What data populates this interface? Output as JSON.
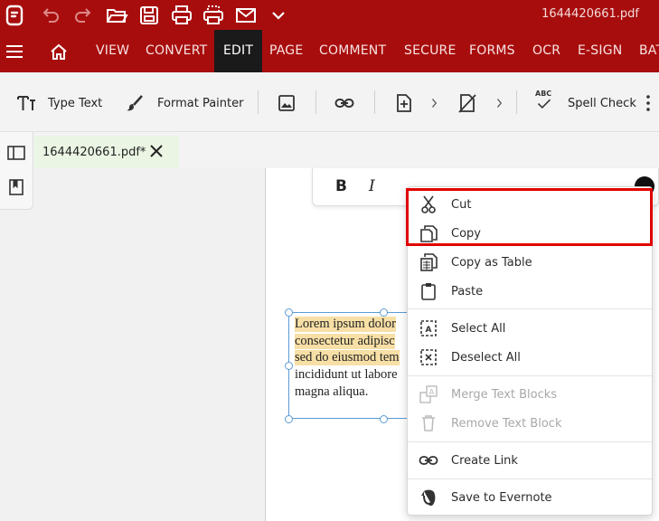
{
  "window": {
    "title": "1644420661.pdf"
  },
  "menubar": {
    "items": [
      {
        "label": "VIEW"
      },
      {
        "label": "CONVERT"
      },
      {
        "label": "EDIT"
      },
      {
        "label": "PAGE"
      },
      {
        "label": "COMMENT"
      },
      {
        "label": "SECURE"
      },
      {
        "label": "FORMS"
      },
      {
        "label": "OCR"
      },
      {
        "label": "E-SIGN"
      },
      {
        "label": "BAT"
      }
    ],
    "active": "EDIT"
  },
  "toolbar": {
    "type_text": "Type Text",
    "format_painter": "Format Painter",
    "spell_check": "Spell Check",
    "abc_badge": "ABC"
  },
  "tab": {
    "filename": "1644420661.pdf*"
  },
  "format_bar": {
    "bold": "B",
    "italic": "I"
  },
  "textbox": {
    "lines": [
      "Lorem ipsum dolor",
      "consectetur adipisc",
      "sed do eiusmod tem",
      "incididunt ut labore",
      "magna aliqua."
    ]
  },
  "context_menu": {
    "items": [
      {
        "label": "Cut",
        "icon": "scissors-icon",
        "enabled": true
      },
      {
        "label": "Copy",
        "icon": "copy-icon",
        "enabled": true
      },
      {
        "label": "Copy as Table",
        "icon": "copy-table-icon",
        "enabled": true
      },
      {
        "label": "Paste",
        "icon": "clipboard-icon",
        "enabled": true
      },
      {
        "label": "Select All",
        "icon": "select-all-icon",
        "enabled": true
      },
      {
        "label": "Deselect All",
        "icon": "deselect-all-icon",
        "enabled": true
      },
      {
        "label": "Merge Text Blocks",
        "icon": "merge-text-icon",
        "enabled": false
      },
      {
        "label": "Remove Text Block",
        "icon": "trash-icon",
        "enabled": false
      },
      {
        "label": "Create Link",
        "icon": "link-icon",
        "enabled": true
      },
      {
        "label": "Save to Evernote",
        "icon": "evernote-icon",
        "enabled": true
      }
    ]
  },
  "colors": {
    "brand": "#a80d0d",
    "highlight_outline": "#e00000",
    "text_highlight": "#f7dfa6",
    "selection_border": "#5b9bd5"
  }
}
